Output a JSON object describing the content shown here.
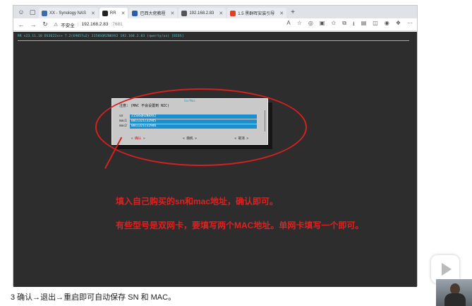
{
  "browser": {
    "tabs": [
      {
        "label": "XX - Synology NAS",
        "favicon_color": "#3a6ea5",
        "active": false
      },
      {
        "label": "RR",
        "favicon_color": "#222222",
        "active": true
      },
      {
        "label": "巴西大佬教程",
        "favicon_color": "#2a5ea8",
        "active": false
      },
      {
        "label": "192.168.2.83",
        "favicon_color": "#555555",
        "active": false
      },
      {
        "label": "1.5 黑群晖安装引导",
        "favicon_color": "#e04020",
        "active": false
      }
    ],
    "new_tab": "+",
    "address": {
      "security": "不安全",
      "url_host": "192.168.2.83",
      "url_port": ":7681"
    }
  },
  "terminal": {
    "header": "RR v23.11.10 DS3622xs+ 7.2(69057u2) 2150SQRZN8XV2 192.168.2.83 (qwerty/us) [BIOS]"
  },
  "dialog": {
    "title": "Sn/Mac",
    "note": "注意: (MAC 不会设置到 NIC)",
    "fields": [
      {
        "label": "sn",
        "value": "2150SQRZN8XV2"
      },
      {
        "label": "mac1",
        "value": "0011321c329d5"
      },
      {
        "label": "mac2",
        "value": "0011321c329d6"
      }
    ],
    "buttons": [
      "< 确认 >",
      "< 随机 >",
      "< 取消 >"
    ]
  },
  "annotation": {
    "line1": "填入自己购买的sn和mac地址，确认即可。",
    "line2": "有些型号是双网卡，要填写两个MAC地址。单网卡填写一个即可。"
  },
  "caption": "3 确认→退出→重启即可自动保存 SN 和 MAC。",
  "colors": {
    "annotation_red": "#e02020",
    "terminal_bg": "#2d2d2d",
    "terminal_text": "#4ad3d9",
    "field_highlight": "#1c8fcf"
  }
}
